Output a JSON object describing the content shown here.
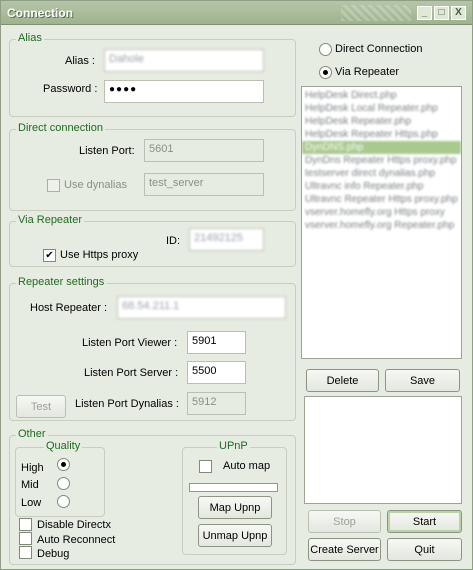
{
  "window": {
    "title": "Connection",
    "minimize": "_",
    "maximize": "□",
    "close": "X"
  },
  "alias": {
    "group": "Alias",
    "alias_label": "Alias :",
    "alias_value": "Dahole",
    "password_label": "Password :",
    "password_value": "●●●●"
  },
  "direct": {
    "group": "Direct connection",
    "listen_port_label": "Listen Port:",
    "listen_port_value": "5601",
    "use_dynalias_label": "Use dynalias",
    "dynalias_value": "test_server"
  },
  "via_repeater": {
    "group": "Via Repeater",
    "id_label": "ID:",
    "id_value": "21492125",
    "use_https_label": "Use Https proxy",
    "use_https_checked": "✔"
  },
  "repeater_settings": {
    "group": "Repeater settings",
    "host_label": "Host Repeater :",
    "host_value": "68.54.211.1",
    "port_viewer_label": "Listen Port Viewer :",
    "port_viewer_value": "5901",
    "port_server_label": "Listen Port Server :",
    "port_server_value": "5500",
    "test_label": "Test",
    "port_dynalias_label": "Listen Port Dynalias :",
    "port_dynalias_value": "5912"
  },
  "other": {
    "group": "Other",
    "quality_group": "Quality",
    "quality_high": "High",
    "quality_mid": "Mid",
    "quality_low": "Low",
    "disable_directx": "Disable Directx",
    "auto_reconnect": "Auto Reconnect",
    "debug": "Debug"
  },
  "upnp": {
    "group": "UPnP",
    "auto_map": "Auto map",
    "progress": 0,
    "map_button": "Map Upnp",
    "unmap_button": "Unmap Upnp"
  },
  "mode": {
    "direct_label": "Direct Connection",
    "repeater_label": "Via Repeater",
    "selected": "repeater"
  },
  "repeater_list": {
    "items": [
      "HelpDesk Direct.php",
      "HelpDesk Local Repeater.php",
      "HelpDesk Repeater.php",
      "HelpDesk Repeater Https.php",
      "DynDNS.php",
      "DynDns Repeater Https proxy.php",
      "testserver direct dynalias.php",
      "Ultravnc info Repeater.php",
      "Ultravnc Repeater Https proxy.php",
      "vserver.homefly.org Https proxy",
      "vserver.homefly.org Repeater.php"
    ],
    "selected_index": 4
  },
  "buttons": {
    "delete": "Delete",
    "save": "Save",
    "stop": "Stop",
    "start": "Start",
    "create_server": "Create Server",
    "quit": "Quit"
  },
  "colors": {
    "accent_green": "#1f6a1f",
    "selection": "#a9c98f",
    "window_bg": "#e7ece3"
  }
}
